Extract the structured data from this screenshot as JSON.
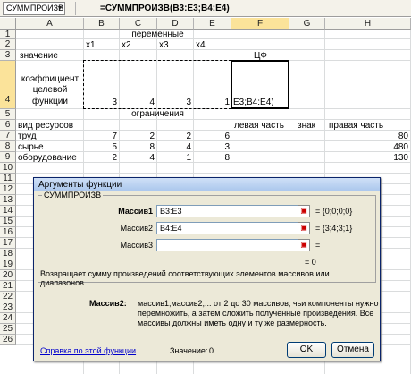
{
  "formula_bar": {
    "name_box": "СУММПРОИЗВ",
    "formula": "=СУММПРОИЗВ(B3:E3;B4:E4)"
  },
  "columns": [
    "A",
    "B",
    "C",
    "D",
    "E",
    "F",
    "G",
    "H"
  ],
  "rows": [
    "1",
    "2",
    "3",
    "4",
    "5",
    "6",
    "7",
    "8",
    "9",
    "10",
    "11",
    "12",
    "13",
    "14",
    "15",
    "16",
    "17",
    "18",
    "19",
    "20",
    "21",
    "22",
    "23",
    "24",
    "25",
    "26"
  ],
  "sheet": {
    "peremennye": "переменные",
    "x1": "x1",
    "x2": "x2",
    "x3": "x3",
    "x4": "x4",
    "znachenie": "значение",
    "cf": "ЦФ",
    "koef1": "коэффициент",
    "koef2": "целевой",
    "koef3": "функции",
    "b4": "3",
    "c4": "4",
    "d4": "3",
    "e4": "1",
    "f4": "E3;B4:E4)",
    "ogranicheniya": "ограничения",
    "vid": "вид ресурсов",
    "levaya": "левая часть",
    "znak": "знак",
    "pravaya": "правая часть",
    "r7": {
      "label": "труд",
      "b": "7",
      "c": "2",
      "d": "2",
      "e": "6",
      "h": "80"
    },
    "r8": {
      "label": "сырье",
      "b": "5",
      "c": "8",
      "d": "4",
      "e": "3",
      "h": "480"
    },
    "r9": {
      "label": "оборудование",
      "b": "2",
      "c": "4",
      "d": "1",
      "e": "8",
      "h": "130"
    }
  },
  "dialog": {
    "title": "Аргументы функции",
    "function_name": "СУММПРОИЗВ",
    "args": [
      {
        "label": "Массив1",
        "value": "B3:E3",
        "result": "= {0;0;0;0}"
      },
      {
        "label": "Массив2",
        "value": "B4:E4",
        "result": "= {3;4;3;1}"
      },
      {
        "label": "Массив3",
        "value": "",
        "result": "="
      }
    ],
    "total": "= 0",
    "description": "Возвращает сумму произведений соответствующих элементов массивов или диапазонов.",
    "arg_help_label": "Массив2:",
    "arg_help_text_1": "массив1;массив2;... от 2 до 30 массивов, чьи компоненты нужно",
    "arg_help_text_2": "перемножить, а затем сложить полученные произведения. Все",
    "arg_help_text_3": "массивы должны иметь одну и ту же размерность.",
    "help_link": "Справка по этой функции",
    "value_label": "Значение:",
    "value": "0",
    "ok": "OK",
    "cancel": "Отмена"
  }
}
